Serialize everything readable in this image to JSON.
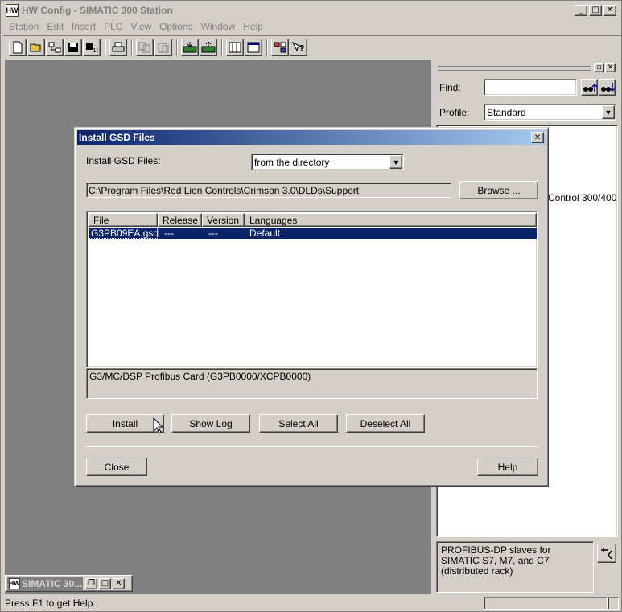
{
  "main": {
    "title": "HW Config - SIMATIC 300 Station",
    "app_icon_text": "HW",
    "menu": [
      "Station",
      "Edit",
      "Insert",
      "PLC",
      "View",
      "Options",
      "Window",
      "Help"
    ]
  },
  "toolbar": {
    "icons": [
      "new-icon",
      "open-icon",
      "network-icon",
      "save-icon",
      "compile-icon",
      "print-icon",
      "copy-icon",
      "paste-icon",
      "download-icon",
      "upload-icon",
      "station-view-icon",
      "detail-view-icon",
      "catalog-icon",
      "help-icon"
    ]
  },
  "mdi_child": {
    "title": "SIMATIC 30...",
    "icon_text": "HW"
  },
  "catalog": {
    "find_label": "Find:",
    "find_value": "",
    "profile_label": "Profile:",
    "profile_value": "Standard",
    "tree_visible_text": "Control 300/400",
    "info_text": "PROFIBUS-DP slaves for SIMATIC S7, M7, and C7 (distributed rack)"
  },
  "status": {
    "text": "Press F1 to get Help."
  },
  "dialog": {
    "title": "Install GSD Files",
    "source_label": "Install GSD Files:",
    "source_value": "from the directory",
    "path": "C:\\Program Files\\Red Lion Controls\\Crimson 3.0\\DLDs\\Support",
    "browse_label": "Browse ...",
    "columns": [
      "File",
      "Release",
      "Version",
      "Languages"
    ],
    "rows": [
      {
        "file": "G3PB09EA.gsd",
        "release": "---",
        "version": "---",
        "languages": "Default",
        "selected": true
      }
    ],
    "description": "G3/MC/DSP Profibus Card (G3PB0000/XCPB0000)",
    "buttons": {
      "install": "Install",
      "show_log": "Show Log",
      "select_all": "Select All",
      "deselect_all": "Deselect All",
      "close": "Close",
      "help": "Help"
    }
  }
}
